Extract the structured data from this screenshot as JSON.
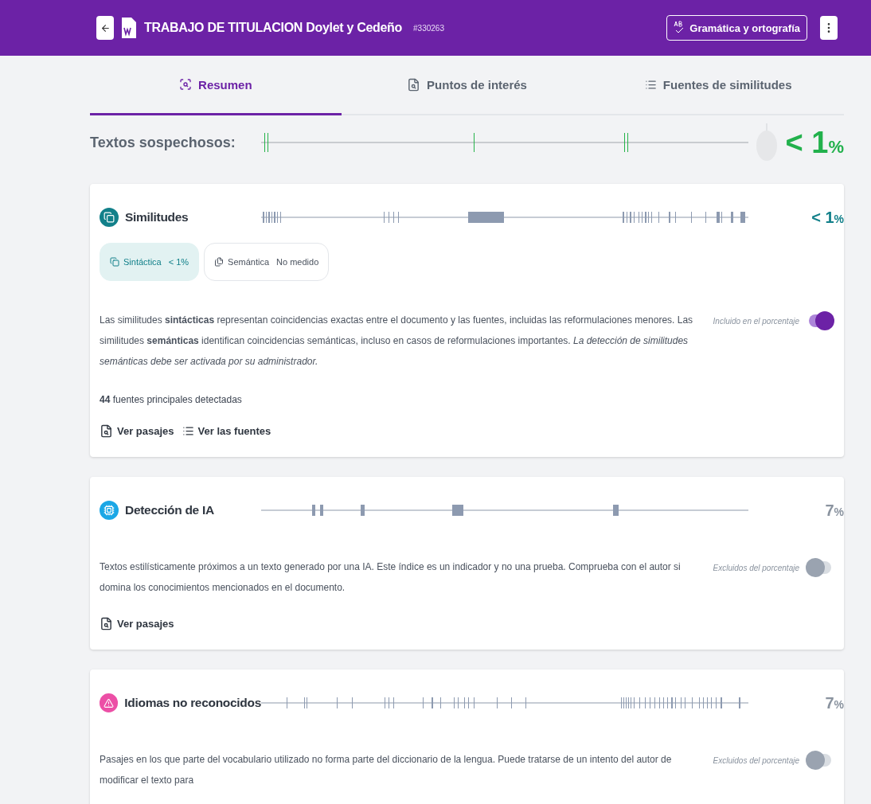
{
  "header": {
    "title": "TRABAJO DE TITULACION Doylet y Cedeño",
    "doc_id": "#330263",
    "grammar_button": "Gramática y ortografía"
  },
  "tabs": [
    {
      "label": "Resumen",
      "kind": "summary",
      "selected": true
    },
    {
      "label": "Puntos de interés",
      "kind": "points",
      "selected": false
    },
    {
      "label": "Fuentes de similitudes",
      "kind": "sources",
      "selected": false
    }
  ],
  "suspicious": {
    "label": "Textos sospechosos:",
    "value": "< 1",
    "unit": "%"
  },
  "sections": [
    {
      "kind": "similarity",
      "title": "Similitudes",
      "value": "< 1",
      "unit": "%",
      "color": "#12808a",
      "chips": [
        {
          "kind": "syntactic",
          "label": "Sintáctica",
          "value": "< 1%",
          "selected": true
        },
        {
          "kind": "semantic",
          "label": "Semántica",
          "value": "No medido",
          "selected": false
        }
      ],
      "description": "Las similitudes **sintácticas** representan coincidencias exactas entre el documento y las fuentes, incluidas las reformulaciones menores. Las similitudes **semánticas** identifican coincidencias semánticas, incluso en casos de reformulaciones importantes. *La detección de similitudes semánticas debe ser activada por su administrador.*",
      "toggle_label": "Incluido en el porcentaje",
      "on": true,
      "sources_count": "44",
      "sources_text": "fuentes principales detectadas",
      "links": [
        {
          "kind": "passages",
          "label": "Ver pasajes"
        },
        {
          "kind": "sources",
          "label": "Ver las fuentes"
        }
      ]
    },
    {
      "kind": "ai",
      "title": "Detección de IA",
      "value": "7",
      "unit": "%",
      "color": "#8a939f",
      "description": "Textos estilísticamente próximos a un texto generado por una IA. Este índice es un indicador y no una prueba. Comprueba con el autor si domina los conocimientos mencionados en el documento.",
      "toggle_label": "Excluidos del porcentaje",
      "on": false,
      "links": [
        {
          "kind": "passages",
          "label": "Ver pasajes"
        }
      ]
    },
    {
      "kind": "language",
      "title": "Idiomas no reconocidos",
      "value": "7",
      "unit": "%",
      "color": "#8a939f",
      "description": "Pasajes en los que parte del vocabulario utilizado no forma parte del diccionario de la lengua. Puede tratarse de un intento del autor de modificar el texto para",
      "toggle_label": "Excluidos del porcentaje",
      "on": false
    }
  ]
}
